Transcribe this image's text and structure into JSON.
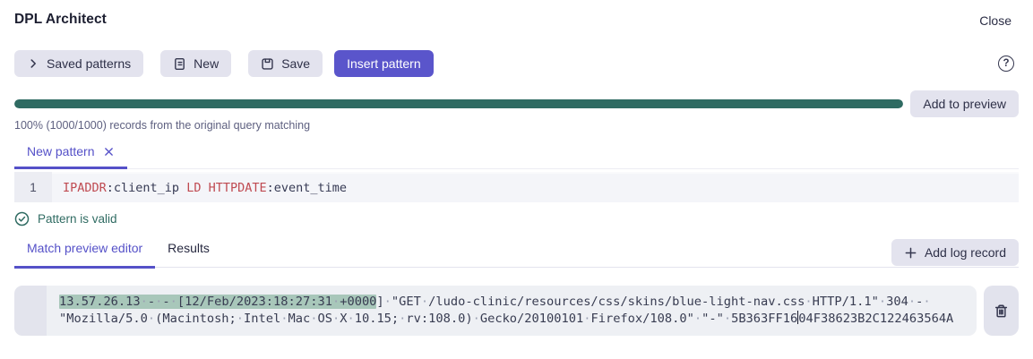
{
  "header": {
    "title": "DPL Architect",
    "close_label": "Close"
  },
  "toolbar": {
    "saved_patterns_label": "Saved patterns",
    "new_label": "New",
    "save_label": "Save",
    "insert_pattern_label": "Insert pattern",
    "help_glyph": "?"
  },
  "progress": {
    "percent": 100,
    "bar_color": "#2f6b62",
    "caption": "100% (1000/1000) records from the original query matching",
    "add_to_preview_label": "Add to preview"
  },
  "pattern_tabs": {
    "active_tab": "New pattern"
  },
  "editor": {
    "line_number": "1",
    "tokens": [
      {
        "text": "IPADDR",
        "type": "keyword"
      },
      {
        "text": ":client_ip ",
        "type": "plain"
      },
      {
        "text": "LD",
        "type": "keyword"
      },
      {
        "text": " ",
        "type": "plain"
      },
      {
        "text": "HTTPDATE",
        "type": "keyword"
      },
      {
        "text": ":event_time",
        "type": "plain"
      }
    ]
  },
  "validation": {
    "message": "Pattern is valid",
    "color": "#2f6b62"
  },
  "preview_tabs": {
    "tabs": [
      {
        "label": "Match preview editor",
        "active": true
      },
      {
        "label": "Results",
        "active": false
      }
    ],
    "add_log_record_label": "Add log record"
  },
  "log_record": {
    "highlight_color": "#a8c7ba",
    "line1_highlight": "13.57.26.13 - - [12/Feb/2023:18:27:31 +0000",
    "line1_rest": "] \"GET /ludo-clinic/resources/css/skins/blue-light-nav.css HTTP/1.1\" 304 - ",
    "line2_before_caret": "\"Mozilla/5.0 (Macintosh; Intel Mac OS X 10.15; rv:108.0) Gecko/20100101 Firefox/108.0\" \"-\" 5B363FF16",
    "line2_after_caret": "04F38623B2C122463564A"
  },
  "colors": {
    "accent": "#5a55cb",
    "teal": "#2f6b62",
    "button_bg": "#e3e3ee"
  }
}
